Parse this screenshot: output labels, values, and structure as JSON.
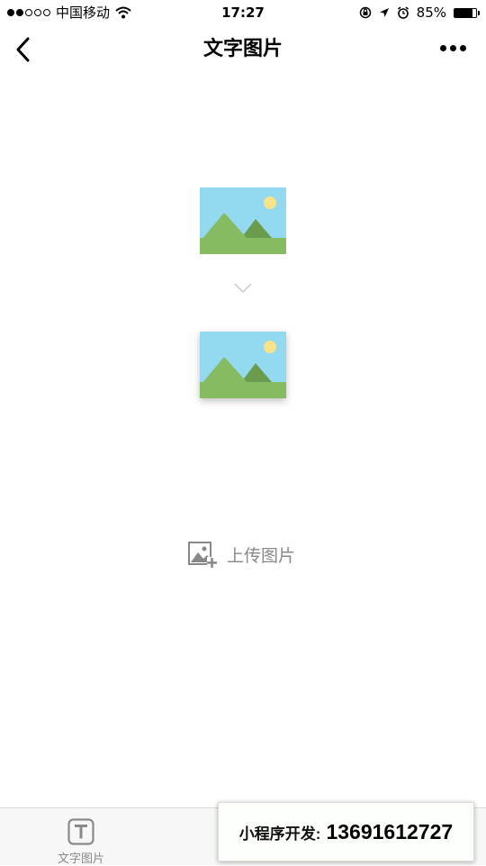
{
  "status_bar": {
    "carrier": "中国移动",
    "time": "17:27",
    "battery_percent": "85%",
    "battery_level": 0.85
  },
  "nav": {
    "title": "文字图片",
    "back_icon": "chevron-left-icon",
    "more_icon": "more-dots-icon"
  },
  "upload": {
    "label": "上传图片",
    "icon": "image-add-icon"
  },
  "tabs": [
    {
      "label": "文字图片",
      "icon": "text-t-icon",
      "active": true
    },
    {
      "label": "",
      "icon": "",
      "active": false
    },
    {
      "label": "",
      "icon": "",
      "active": false
    }
  ],
  "promo": {
    "label": "小程序开发:",
    "number": "13691612727"
  },
  "colors": {
    "sky": "#93d9ef",
    "grass": "#86bb62",
    "mountain_dark": "#6a9c4e",
    "sun": "#f8e28a",
    "muted_text": "#888888",
    "tab_bar_bg": "#f7f7f7"
  }
}
